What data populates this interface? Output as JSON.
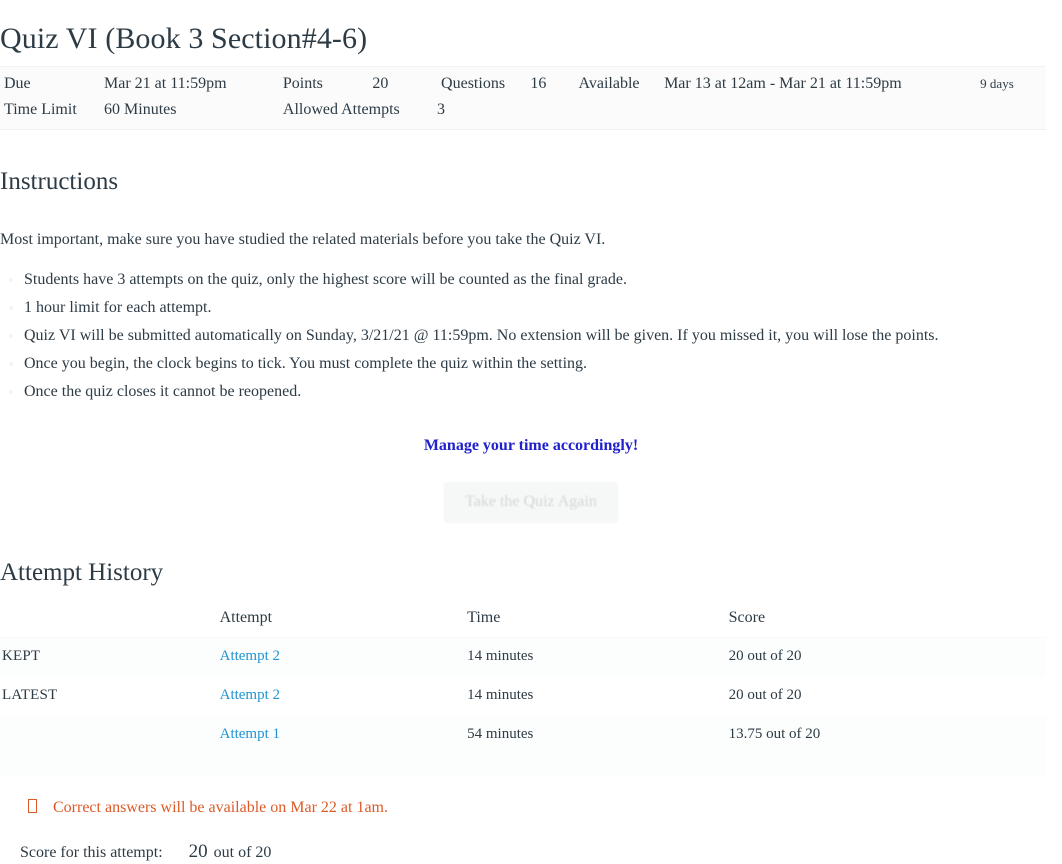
{
  "quiz": {
    "title": "Quiz VI (Book 3 Section#4-6)"
  },
  "header_details": {
    "due_label": "Due",
    "due_value": "Mar 21 at 11:59pm",
    "points_label": "Points",
    "points_value": "20",
    "questions_label": "Questions",
    "questions_value": "16",
    "available_label": "Available",
    "available_value": "Mar 13 at 12am - Mar 21 at 11:59pm",
    "available_days": "9 days",
    "time_limit_label": "Time Limit",
    "time_limit_value": "60 Minutes",
    "allowed_attempts_label": "Allowed Attempts",
    "allowed_attempts_value": "3"
  },
  "instructions": {
    "heading": "Instructions",
    "intro": "Most important, make sure you have studied the related materials before you take the Quiz VI.",
    "bullets": [
      "Students have 3 attempts on the quiz, only the highest score will be counted as the final grade.",
      "1 hour limit for each attempt.",
      "Quiz VI will be submitted automatically on Sunday, 3/21/21 @ 11:59pm. No extension will be given. If you missed it, you will lose the points.",
      "Once you begin, the clock begins to tick. You must complete the quiz within the setting.",
      "Once the quiz closes it cannot be reopened."
    ],
    "emphasis": "Manage your time accordingly!",
    "emphasis_color": "#2020cc"
  },
  "actions": {
    "take_quiz_again": "Take the Quiz Again"
  },
  "attempt_history": {
    "heading": "Attempt History",
    "columns": [
      "",
      "Attempt",
      "Time",
      "Score"
    ],
    "rows": [
      {
        "marker": "KEPT",
        "attempt": "Attempt 2",
        "time": "14 minutes",
        "score": "20 out of 20"
      },
      {
        "marker": "LATEST",
        "attempt": "Attempt 2",
        "time": "14 minutes",
        "score": "20 out of 20"
      },
      {
        "marker": "",
        "attempt": "Attempt 1",
        "time": "54 minutes",
        "score": "13.75 out of 20"
      }
    ],
    "link_color": "#2195d4"
  },
  "answers_note": {
    "icon": "info-icon",
    "text": "Correct answers will be available on Mar 22 at 1am.",
    "color": "#dd5a28"
  },
  "score_summary": {
    "label": "Score for this attempt:",
    "value": "20",
    "out_of": "out of 20"
  }
}
